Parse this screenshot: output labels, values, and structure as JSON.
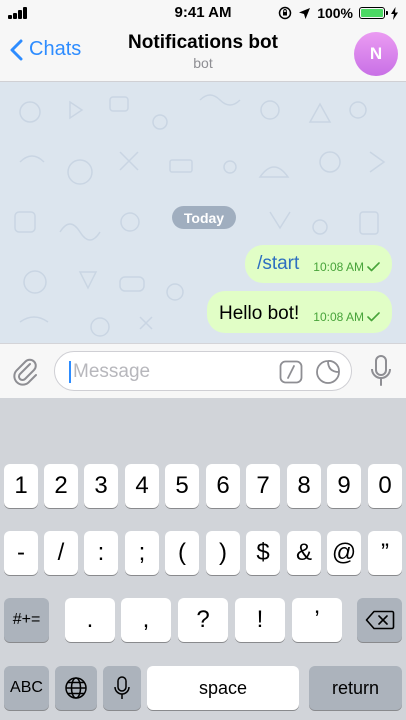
{
  "status_bar": {
    "time": "9:41 AM",
    "battery_percent": "100%",
    "battery_level": 1.0,
    "battery_color": "#4cd964",
    "icons": [
      "signal-bars-icon",
      "orientation-lock-icon",
      "location-arrow-icon",
      "battery-icon",
      "charging-bolt-icon"
    ]
  },
  "header": {
    "back_label": "Chats",
    "title": "Notifications bot",
    "subtitle": "bot",
    "avatar_initial": "N",
    "accent_color": "#2d8cff"
  },
  "chat": {
    "date_separator": "Today",
    "messages": [
      {
        "text": "/start",
        "time": "10:08 AM",
        "status": "read",
        "kind": "command"
      },
      {
        "text": "Hello bot!",
        "time": "10:08 AM",
        "status": "read",
        "kind": "text"
      }
    ],
    "bubble_color": "#e1fec6"
  },
  "composer": {
    "placeholder": "Message",
    "value": "",
    "icons": [
      "attachment-icon",
      "bot-command-icon",
      "sticker-icon",
      "microphone-icon"
    ]
  },
  "keyboard": {
    "row1": [
      "1",
      "2",
      "3",
      "4",
      "5",
      "6",
      "7",
      "8",
      "9",
      "0"
    ],
    "row2": [
      "-",
      "/",
      ":",
      ";",
      "(",
      ")",
      "$",
      "&",
      "@",
      "”"
    ],
    "row3_left": "#+=",
    "row3": [
      ".",
      ",",
      "?",
      "!",
      "’"
    ],
    "row4": {
      "abc": "ABC",
      "space": "space",
      "return": "return"
    }
  }
}
